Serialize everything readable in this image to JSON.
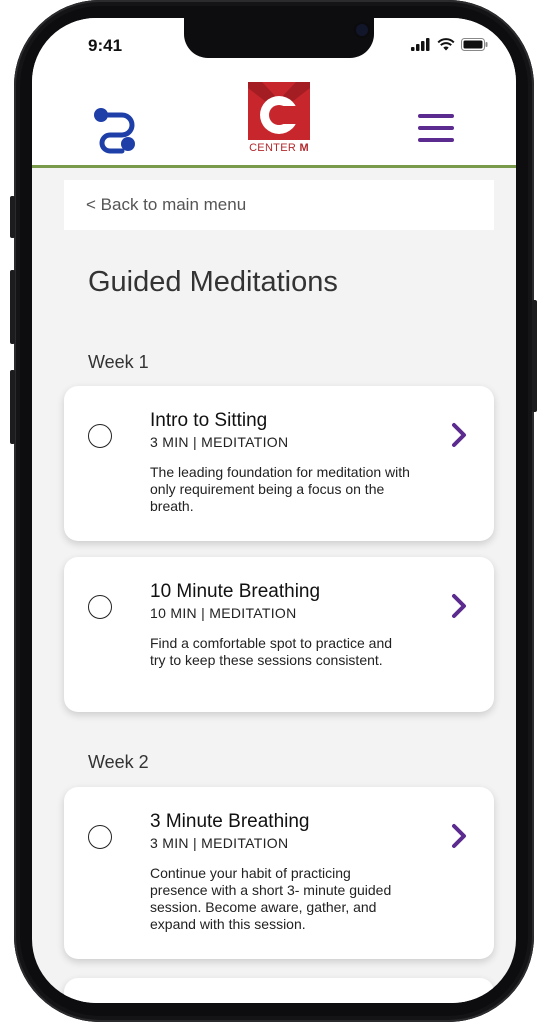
{
  "status": {
    "time": "9:41"
  },
  "header": {
    "logo_text": "CENTER",
    "logo_letter": "M"
  },
  "nav": {
    "back_label": "< Back to main menu"
  },
  "page": {
    "title": "Guided Meditations"
  },
  "weeks": [
    {
      "label": "Week 1",
      "sessions": [
        {
          "title": "Intro to Sitting",
          "meta": "3 MIN | MEDITATION",
          "description": "The leading foundation for meditation with only requirement being a focus on the breath."
        },
        {
          "title": "10 Minute Breathing",
          "meta": "10 MIN | MEDITATION",
          "description": "Find a comfortable spot to practice and try to keep these sessions consistent."
        }
      ]
    },
    {
      "label": "Week 2",
      "sessions": [
        {
          "title": "3 Minute Breathing",
          "meta": "3 MIN | MEDITATION",
          "description": "Continue your habit of practicing presence with a short 3- minute guided session. Become aware, gather, and expand with this session."
        }
      ]
    }
  ],
  "colors": {
    "brand_red": "#c8262d",
    "accent_purple": "#5b2b8f",
    "route_icon_blue": "#1e3fa8",
    "divider_green": "#7a9a4b"
  },
  "icons": {
    "route": "route-icon",
    "menu": "hamburger-menu-icon",
    "chevron": "chevron-right-icon",
    "radio": "radio-unchecked-icon"
  }
}
